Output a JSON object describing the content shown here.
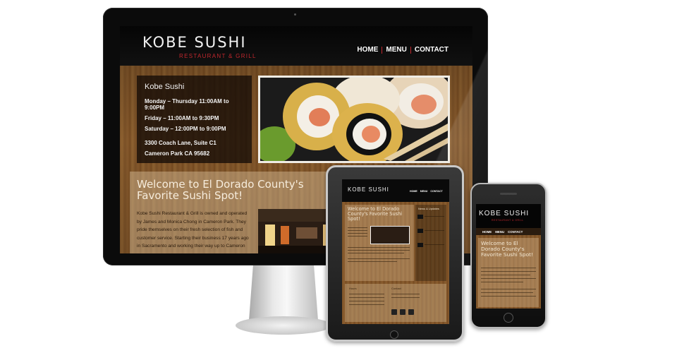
{
  "site": {
    "logo_text": "KOBE SUSHI",
    "logo_subtitle": "RESTAURANT & GRILL",
    "nav": [
      "HOME",
      "MENU",
      "CONTACT"
    ]
  },
  "hours_box": {
    "title": "Kobe Sushi",
    "lines": [
      "Monday – Thursday 11:00AM to 9:00PM",
      "Friday – 11:00AM to 9:30PM",
      "Saturday – 12:00PM to 9:00PM"
    ],
    "address": [
      "3300 Coach Lane, Suite C1",
      "Cameron Park CA 95682"
    ]
  },
  "welcome": {
    "title": "Welcome to El Dorado County's Favorite Sushi Spot!",
    "text": "Kobe Sushi Restaurant & Grill is owned and operated by James and Monica Chong in Cameron Park. They pride themselves on their fresh selection of fish and customer service. Starting their business 17 years ago in Sacramento and working their way up to Cameron"
  },
  "tablet": {
    "logo_text": "KOBE SUSHI",
    "nav": [
      "HOME",
      "MENU",
      "CONTACT"
    ],
    "welcome_title": "Welcome to El Dorado County's Favorite Sushi Spot!",
    "sidebar_title": "News & Updates",
    "footer_left": "Hours",
    "footer_right": "Contact"
  },
  "phone": {
    "logo_text": "KOBE SUSHI",
    "logo_subtitle": "RESTAURANT & GRILL",
    "nav": [
      "HOME",
      "MENU",
      "CONTACT"
    ],
    "welcome_title": "Welcome to El Dorado County's Favorite Sushi Spot!"
  },
  "colors": {
    "accent_red": "#c0272d",
    "wood": "#7e5428",
    "header": "#050505"
  }
}
